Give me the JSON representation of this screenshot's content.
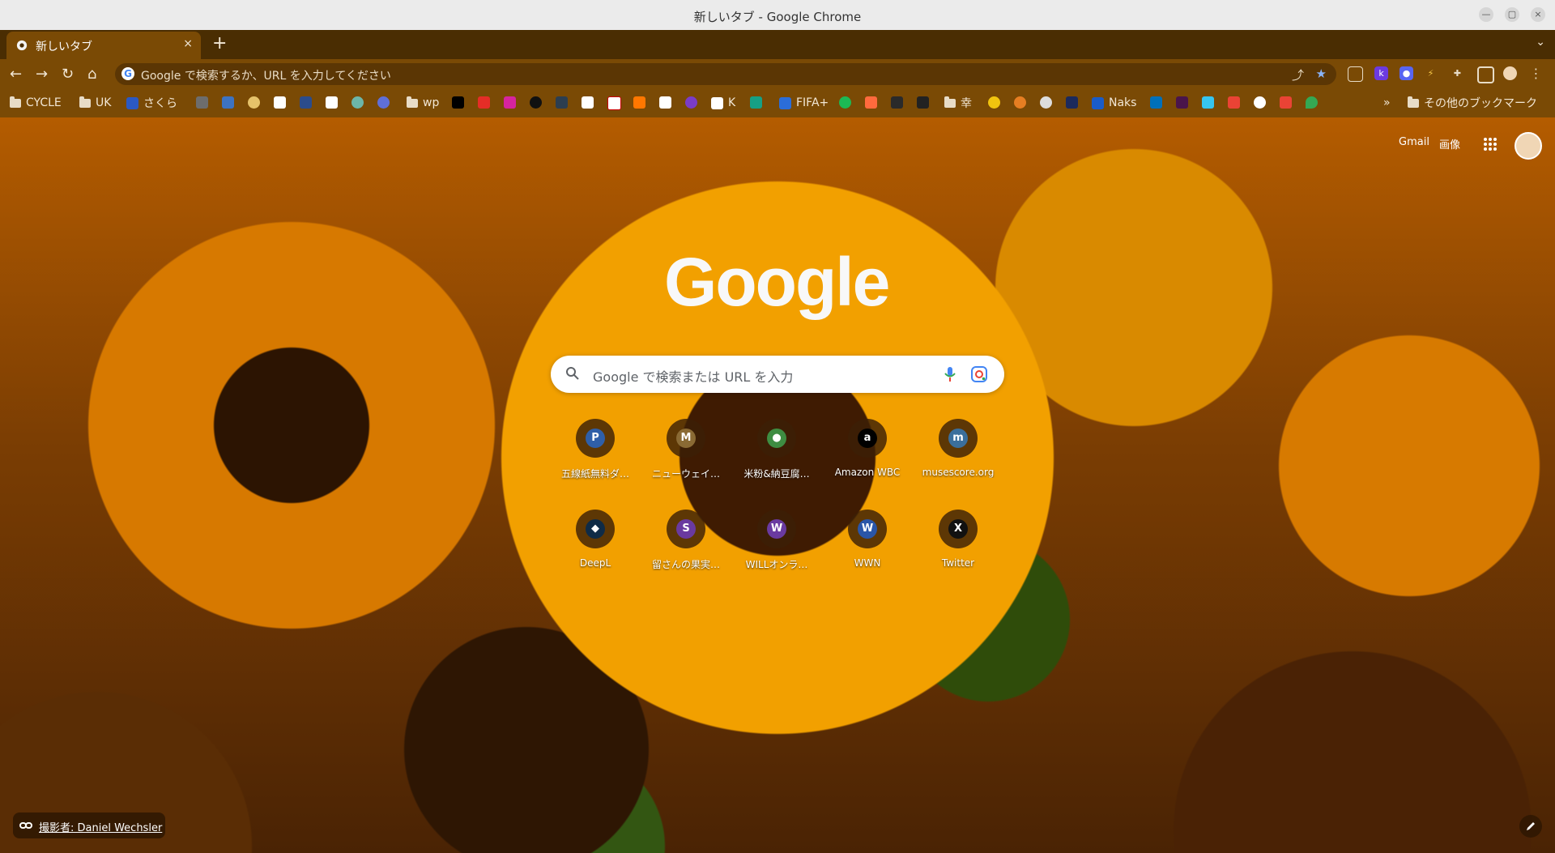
{
  "window": {
    "title": "新しいタブ - Google Chrome"
  },
  "tab": {
    "title": "新しいタブ",
    "close": "×"
  },
  "toolbar": {
    "new_tab": "+",
    "menu": "⌄",
    "back": "←",
    "forward": "→",
    "reload": "↻",
    "home": "⌂"
  },
  "omnibox": {
    "placeholder": "Google で検索するか、URL を入力してください",
    "share": "⤴",
    "star": "★"
  },
  "bookmarks": {
    "cycle": "CYCLE",
    "uk": "UK",
    "sakura": "さくら",
    "wp": "wp",
    "k": "K",
    "fifa": "FIFA+",
    "kou": "幸",
    "naks": "Naks",
    "more": "»",
    "other": "その他のブックマーク"
  },
  "top_links": {
    "gmail": "Gmail",
    "images": "画像"
  },
  "logo": "Google",
  "search": {
    "placeholder": "Google で検索または URL を入力"
  },
  "shortcuts": [
    {
      "label": "五線紙無料ダ…",
      "letter": "P",
      "color": "#2f5fa8"
    },
    {
      "label": "ニューウェイ…",
      "letter": "M",
      "color": "#8a6a34"
    },
    {
      "label": "米粉&納豆腐…",
      "letter": "●",
      "color": "#3e8d42"
    },
    {
      "label": "Amazon WBC",
      "letter": "a",
      "color": "#000000"
    },
    {
      "label": "musescore.org",
      "letter": "m",
      "color": "#3b6f9c"
    },
    {
      "label": "DeepL",
      "letter": "◆",
      "color": "#0f2b46"
    },
    {
      "label": "留さんの果実…",
      "letter": "S",
      "color": "#6a3aa0"
    },
    {
      "label": "WILLオンラ…",
      "letter": "W",
      "color": "#6a3aa0"
    },
    {
      "label": "WWN",
      "letter": "W",
      "color": "#2a56a8"
    },
    {
      "label": "Twitter",
      "letter": "X",
      "color": "#111111"
    }
  ],
  "credit": {
    "text": "撮影者: Daniel Wechsler"
  }
}
